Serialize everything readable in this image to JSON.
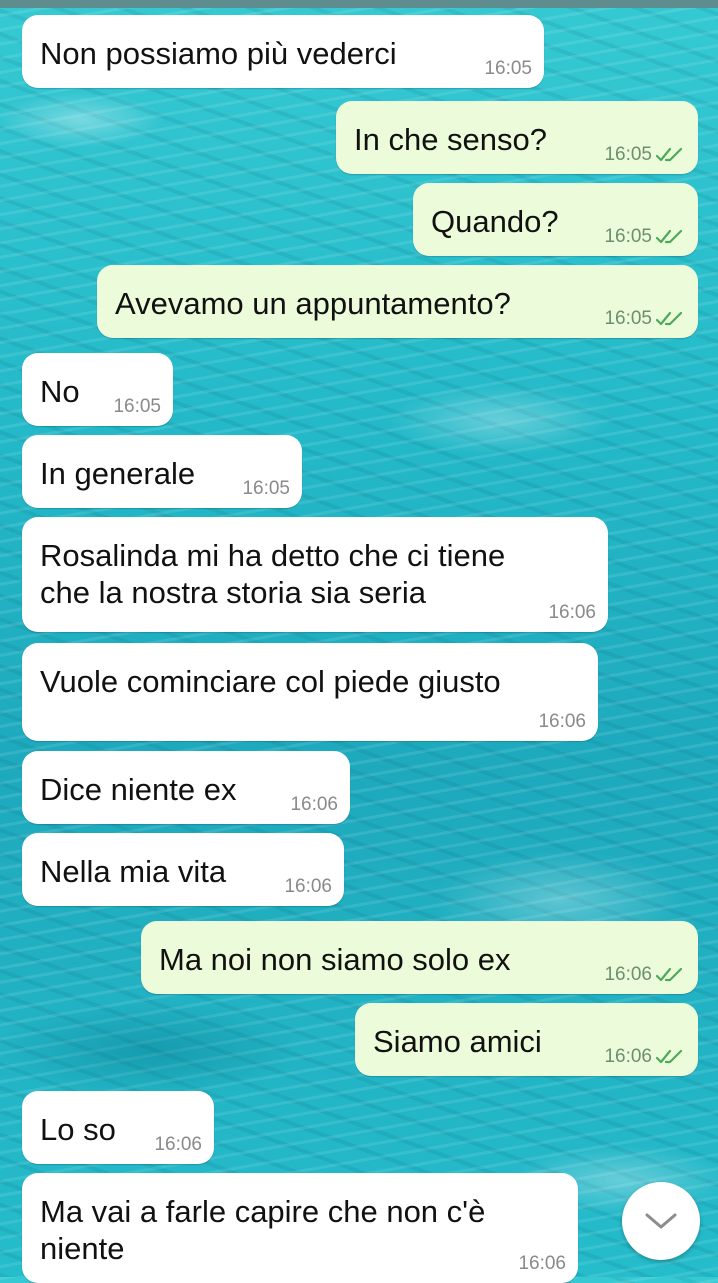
{
  "messages": [
    {
      "dir": "in",
      "text": "Non possiamo più vederci",
      "time": "16:05"
    },
    {
      "dir": "out",
      "text": "In che senso?",
      "time": "16:05",
      "status": "read"
    },
    {
      "dir": "out",
      "text": "Quando?",
      "time": "16:05",
      "status": "read"
    },
    {
      "dir": "out",
      "text": "Avevamo un appuntamento?",
      "time": "16:05",
      "status": "read"
    },
    {
      "dir": "in",
      "text": "No",
      "time": "16:05"
    },
    {
      "dir": "in",
      "text": "In generale",
      "time": "16:05"
    },
    {
      "dir": "in",
      "text": "Rosalinda mi ha detto che ci tiene\nche la nostra storia sia seria",
      "time": "16:06"
    },
    {
      "dir": "in",
      "text": "Vuole cominciare col piede giusto",
      "time": "16:06"
    },
    {
      "dir": "in",
      "text": "Dice niente ex",
      "time": "16:06"
    },
    {
      "dir": "in",
      "text": "Nella mia vita",
      "time": "16:06"
    },
    {
      "dir": "out",
      "text": "Ma noi non siamo solo ex",
      "time": "16:06",
      "status": "read"
    },
    {
      "dir": "out",
      "text": "Siamo amici",
      "time": "16:06",
      "status": "read"
    },
    {
      "dir": "in",
      "text": "Lo so",
      "time": "16:06"
    },
    {
      "dir": "in",
      "text": "Ma vai a farle capire che non c'è\nniente",
      "time": "16:06"
    }
  ],
  "scroll_button": {
    "icon": "chevron-down-icon"
  },
  "colors": {
    "incoming_bubble": "#ffffff",
    "outgoing_bubble": "#ecfbd9",
    "read_ticks": "#4fa95a"
  }
}
